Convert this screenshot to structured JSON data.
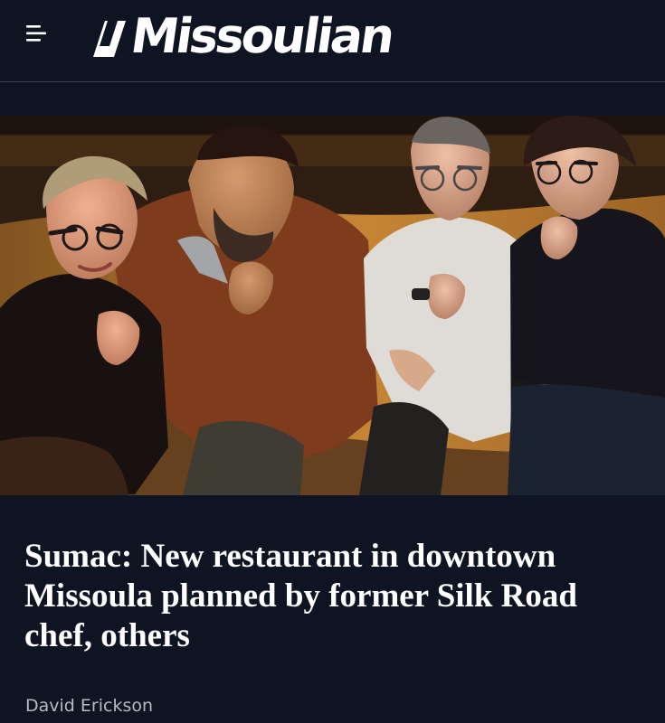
{
  "header": {
    "menu_icon": "hamburger-menu-icon",
    "logo_text": "Missoulian",
    "background_color": "#0f1422"
  },
  "article": {
    "headline": "Sumac: New restaurant in downtown Missoula planned by former Silk Road chef, others",
    "byline": "David Erickson"
  }
}
